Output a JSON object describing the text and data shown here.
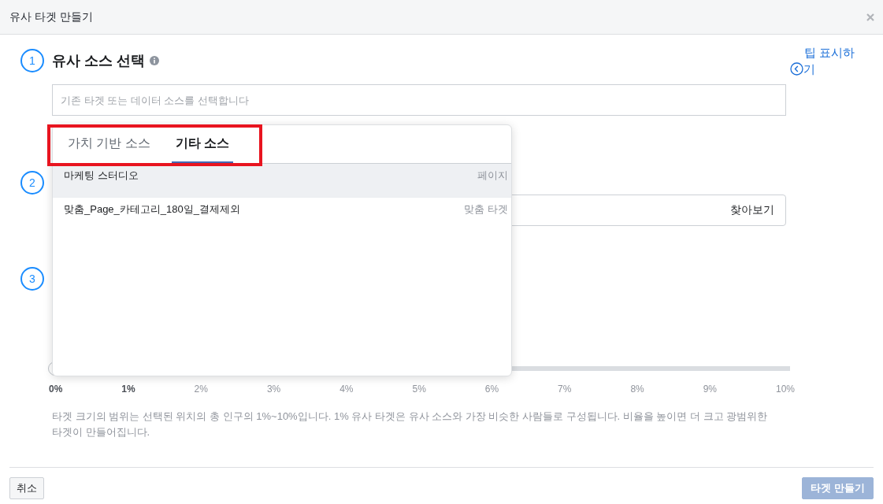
{
  "window": {
    "title": "유사 타겟 만들기"
  },
  "tips_link": "팁 표시하기",
  "steps": [
    {
      "number": "1",
      "title": "유사 소스 선택",
      "field": {
        "placeholder": "기존 타겟 또는 데이터 소스를 선택합니다"
      }
    },
    {
      "number": "2",
      "field": {
        "button": "찾아보기"
      }
    },
    {
      "number": "3"
    }
  ],
  "slider": {
    "level": 0,
    "ticks": [
      {
        "label": "0%",
        "bold": true
      },
      {
        "label": "1%",
        "bold": true
      },
      {
        "label": "2%",
        "bold": false
      },
      {
        "label": "3%",
        "bold": false
      },
      {
        "label": "4%",
        "bold": false
      },
      {
        "label": "5%",
        "bold": false
      },
      {
        "label": "6%",
        "bold": false
      },
      {
        "label": "7%",
        "bold": false
      },
      {
        "label": "8%",
        "bold": false
      },
      {
        "label": "9%",
        "bold": false
      },
      {
        "label": "10%",
        "bold": false
      }
    ]
  },
  "description": "타겟 크기의 범위는 선택된 위치의 총 인구의 1%~10%입니다. 1% 유사 타겟은 유사 소스와 가장 비슷한 사람들로 구성됩니다. 비율을 높이면 더 크고 광범위한 타겟이 만들어집니다.",
  "popup": {
    "tabs": [
      {
        "label": "가치 기반 소스",
        "selected": false
      },
      {
        "label": "기타 소스",
        "selected": true
      }
    ],
    "items": [
      {
        "name": "마케팅 스터디오",
        "type": "페이지",
        "selected": true
      },
      {
        "name": "맞춤_Page_카테고리_180일_결제제외",
        "type": "맞춤 타겟",
        "selected": false
      }
    ]
  },
  "footer": {
    "cancel": "취소",
    "create": {
      "label": "타겟 만들기",
      "disabled": true
    }
  }
}
